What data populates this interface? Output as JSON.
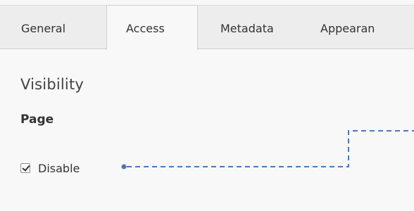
{
  "tabs": [
    {
      "label": "General",
      "active": false
    },
    {
      "label": "Access",
      "active": true
    },
    {
      "label": "Metadata",
      "active": false
    },
    {
      "label": "Appearan",
      "active": false
    }
  ],
  "section": {
    "heading": "Visibility",
    "group_label": "Page",
    "checkbox": {
      "label": "Disable",
      "checked": true
    }
  },
  "colors": {
    "connector": "#4a78b5",
    "tab_bar": "#ededed",
    "panel": "#f8f8f8"
  }
}
